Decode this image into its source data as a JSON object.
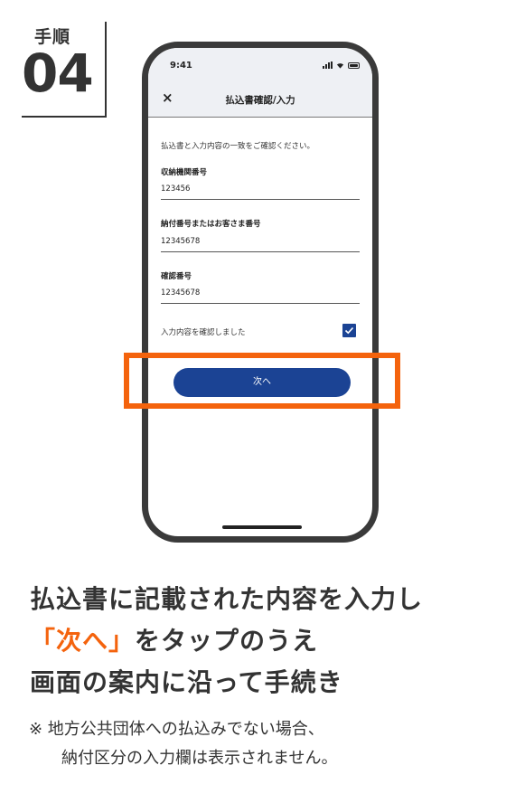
{
  "step": {
    "title": "手順",
    "number": "04"
  },
  "phone": {
    "status": {
      "time": "9:41"
    },
    "nav": {
      "close_icon": "×",
      "title": "払込書確認/入力"
    },
    "instruction": "払込書と入力内容の一致をご確認ください。",
    "fields": [
      {
        "label": "収納機関番号",
        "value": "123456"
      },
      {
        "label": "納付番号またはお客さま番号",
        "value": "12345678"
      },
      {
        "label": "確認番号",
        "value": "12345678"
      }
    ],
    "confirm_label": "入力内容を確認しました",
    "confirm_checked": true,
    "next_button": "次へ"
  },
  "highlight_color": "#f4630d",
  "caption": {
    "line1": "払込書に記載された内容を入力し",
    "line2_highlight": "「次へ」",
    "line2_rest": "をタップのうえ",
    "line3": "画面の案内に沿って手続き"
  },
  "note": {
    "line1": "※ 地方公共団体への払込みでない場合、",
    "line2": "納付区分の入力欄は表示されません。"
  }
}
